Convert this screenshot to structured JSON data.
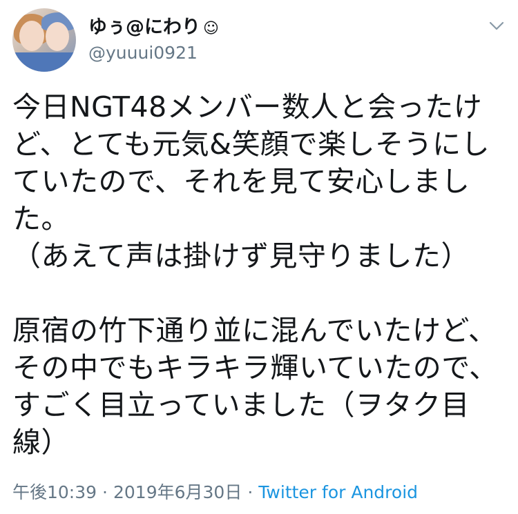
{
  "user": {
    "display_name": "ゆぅ@にわり",
    "emoji": "☺",
    "handle": "@yuuui0921"
  },
  "tweet": {
    "lines": [
      "今日NGT48メンバー数人と会ったけ",
      "ど、とても元気&笑顔で楽しそうにし",
      "ていたので、それを見て安心しまし",
      "た。",
      "（あえて声は掛けず見守りました）",
      "",
      "原宿の竹下通り並に混んでいたけど、",
      "その中でもキラキラ輝いていたので、",
      "すごく目立っていました（ヲタク目",
      "線）"
    ]
  },
  "footer": {
    "time": "午後10:39",
    "separator": "·",
    "date": "2019年6月30日",
    "client": "Twitter for Android"
  },
  "icons": {
    "more": "chevron-down-icon"
  },
  "colors": {
    "text": "#14171a",
    "secondary": "#657786",
    "link": "#1b95e0"
  }
}
